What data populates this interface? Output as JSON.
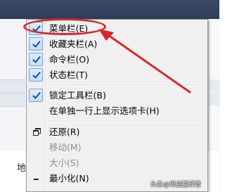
{
  "menu": {
    "items": [
      {
        "label": "菜单栏(E)",
        "checked": true,
        "disabled": false
      },
      {
        "label": "收藏夹栏(A)",
        "checked": true,
        "disabled": false
      },
      {
        "label": "命令栏(O)",
        "checked": true,
        "disabled": false
      },
      {
        "label": "状态栏(T)",
        "checked": true,
        "disabled": false
      },
      {
        "label": "锁定工具栏(B)",
        "checked": true,
        "disabled": false
      },
      {
        "label": "在单独一行上显示选项卡(H)",
        "checked": false,
        "disabled": false
      },
      {
        "label": "还原(R)",
        "icon": "restore-icon",
        "disabled": false
      },
      {
        "label": "移动(M)",
        "disabled": true
      },
      {
        "label": "大小(S)",
        "disabled": true
      },
      {
        "label": "最小化(N)",
        "icon": "minimize-icon",
        "disabled": false
      }
    ]
  },
  "background": {
    "partial_text": "地"
  },
  "annotation": {
    "color": "#d6272e"
  },
  "watermark": "头条@讯店翻译官"
}
